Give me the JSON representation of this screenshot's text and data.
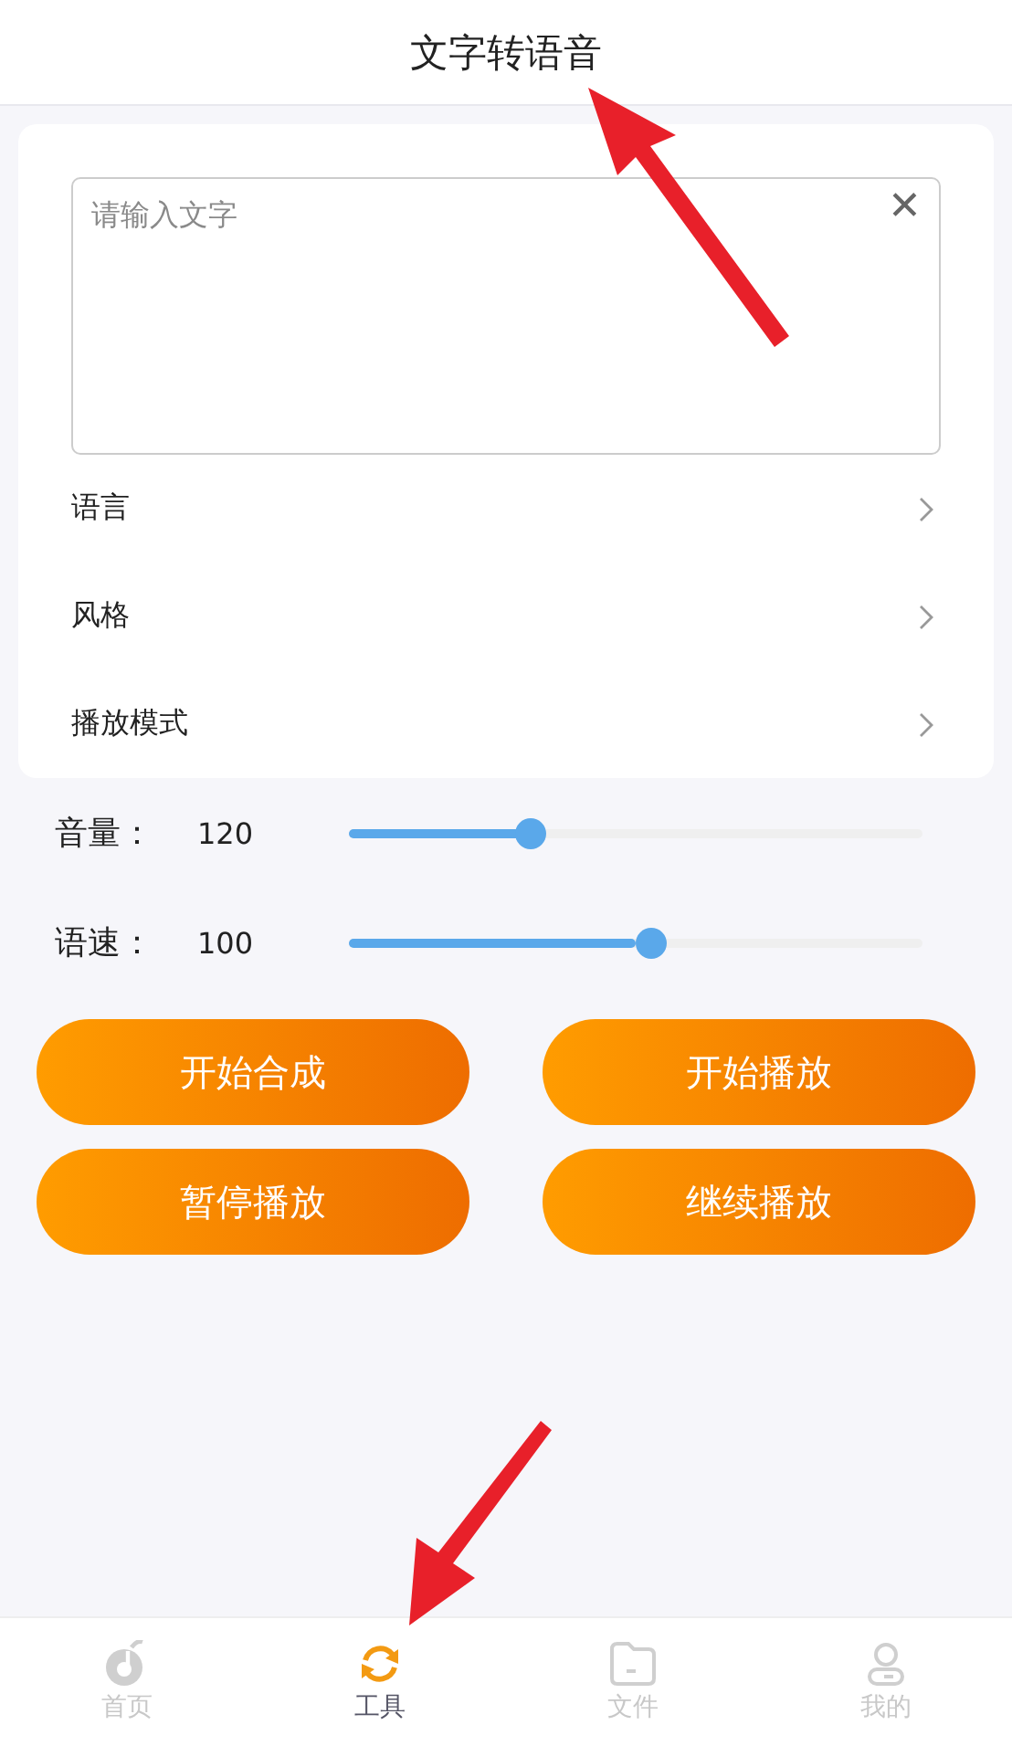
{
  "header": {
    "title": "文字转语音"
  },
  "text_input": {
    "placeholder": "请输入文字",
    "clear": "✕"
  },
  "options": [
    {
      "label": "语言"
    },
    {
      "label": "风格"
    },
    {
      "label": "播放模式"
    }
  ],
  "sliders": [
    {
      "label": "音量：",
      "reading": "120",
      "level": 0.3
    },
    {
      "label": "语速：",
      "reading": "100",
      "level": 0.5
    }
  ],
  "buttons": [
    "开始合成",
    "开始播放",
    "暂停播放",
    "继续播放"
  ],
  "tab_bar": [
    {
      "kind": "home",
      "label": "首页",
      "selected": false
    },
    {
      "kind": "tools",
      "label": "工具",
      "selected": true
    },
    {
      "kind": "files",
      "label": "文件",
      "selected": false
    },
    {
      "kind": "profile",
      "label": "我的",
      "selected": false
    }
  ]
}
